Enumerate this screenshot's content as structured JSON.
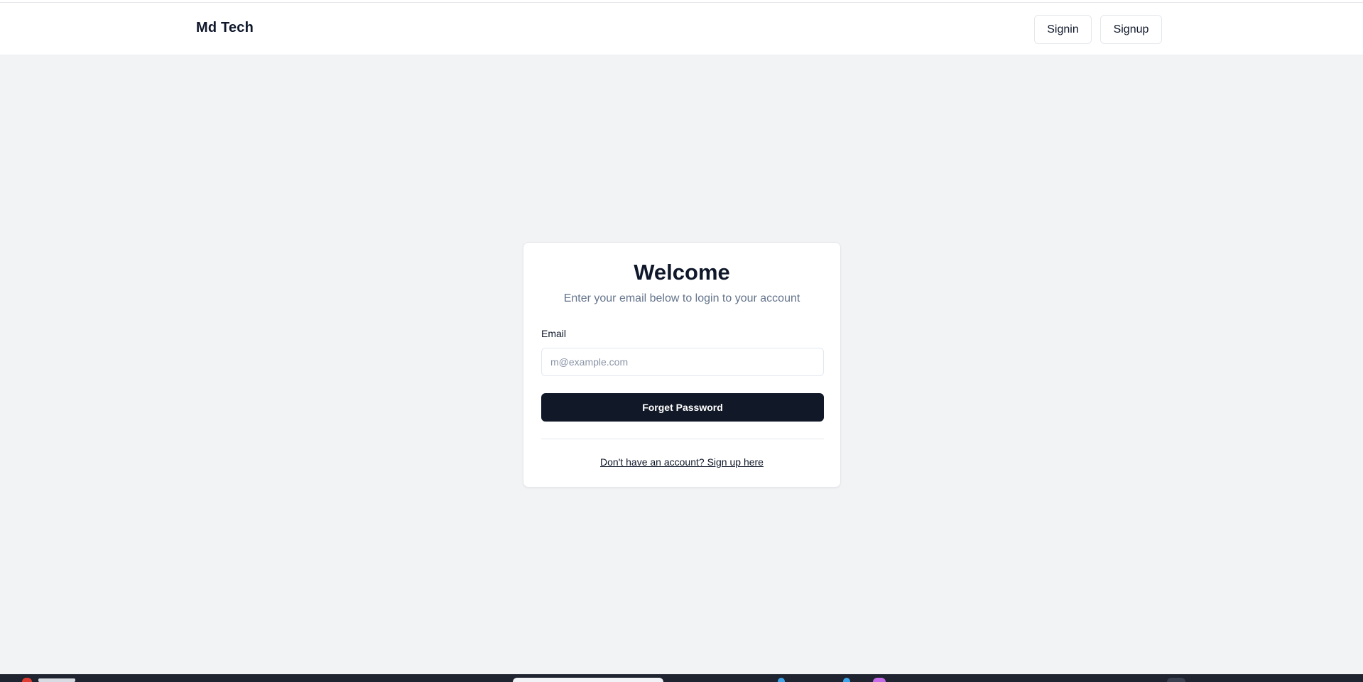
{
  "header": {
    "brand": "Md Tech",
    "signin_label": "Signin",
    "signup_label": "Signup"
  },
  "card": {
    "title": "Welcome",
    "subtitle": "Enter your email below to login to your account",
    "email_label": "Email",
    "email_value": "",
    "email_placeholder": "m@example.com",
    "submit_label": "Forget Password",
    "signup_link": "Don't have an account? Sign up here"
  },
  "colors": {
    "page_background": "#f2f3f5",
    "primary_button": "#111827",
    "subtitle_text": "#64748b"
  }
}
